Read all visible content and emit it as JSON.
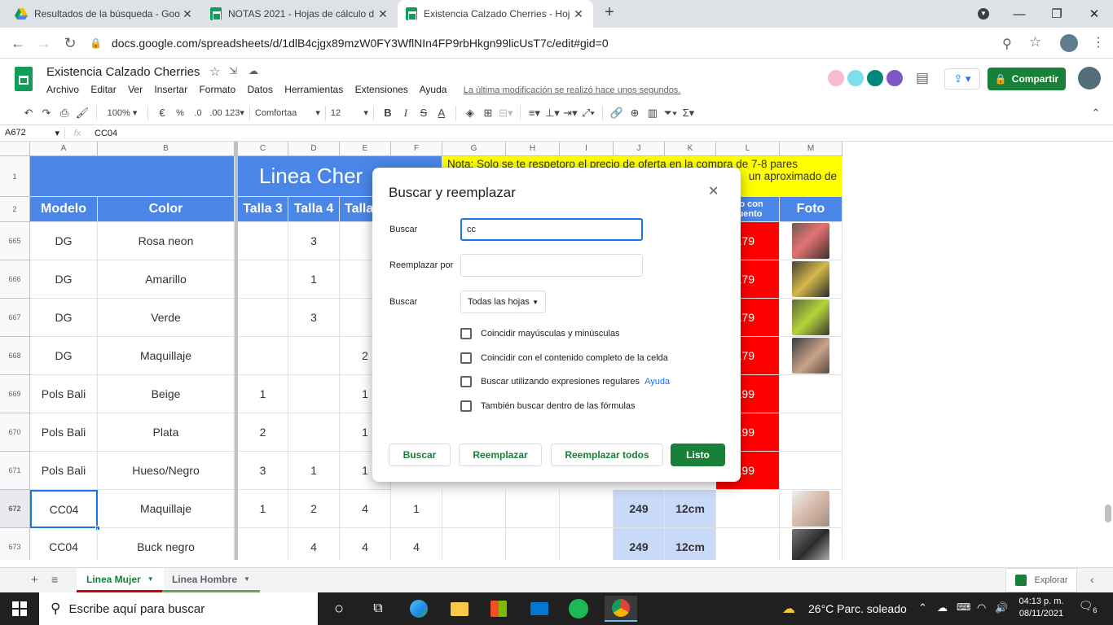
{
  "browser": {
    "tabs": [
      {
        "title": "Resultados de la búsqueda - Goo",
        "active": false,
        "icon": "drive-icon"
      },
      {
        "title": "NOTAS 2021 - Hojas de cálculo d",
        "active": false,
        "icon": "sheets-icon"
      },
      {
        "title": "Existencia Calzado Cherries - Hoj",
        "active": true,
        "icon": "sheets-icon"
      }
    ],
    "new_tab": "+",
    "url": "docs.google.com/spreadsheets/d/1dlB4cjgx89mzW0FY3WflNIn4FP9rbHkgn99licUsT7c/edit#gid=0"
  },
  "doc": {
    "title": "Existencia Calzado Cherries",
    "menu": [
      "Archivo",
      "Editar",
      "Ver",
      "Insertar",
      "Formato",
      "Datos",
      "Herramientas",
      "Extensiones",
      "Ayuda"
    ],
    "last_edit": "La última modificación se realizó hace unos segundos.",
    "share": "Compartir"
  },
  "toolbar": {
    "zoom": "100%",
    "currency": "€",
    "percent": "%",
    "dec_less": ".0",
    "dec_more": ".00",
    "format": "123",
    "font": "Comfortaa",
    "size": "12"
  },
  "formula_bar": {
    "cell_ref": "A672",
    "fx": "fx",
    "content": "CC04"
  },
  "sheet": {
    "columns": [
      "A",
      "B",
      "C",
      "D",
      "E",
      "F",
      "G",
      "H",
      "I",
      "J",
      "K",
      "L",
      "M"
    ],
    "row1_title": "Linea Cher",
    "note": "Nota: Solo se te respetoro el precio de oferta en la compra de 7-8 pares",
    "note2": "un aproximado de",
    "headers": {
      "modelo": "Modelo",
      "color": "Color",
      "t3": "Talla 3",
      "t4": "Talla 4",
      "t5": "Talla",
      "precio": "cio con\ncuento",
      "foto": "Foto"
    },
    "rows": [
      {
        "num": "665",
        "modelo": "DG",
        "color": "Rosa neon",
        "t3": "",
        "t4": "3",
        "t5": "",
        "t6": "",
        "j": "",
        "k": "",
        "l": "179",
        "photo": true
      },
      {
        "num": "666",
        "modelo": "DG",
        "color": "Amarillo",
        "t3": "",
        "t4": "1",
        "t5": "",
        "t6": "",
        "j": "",
        "k": "",
        "l": "179",
        "photo": true
      },
      {
        "num": "667",
        "modelo": "DG",
        "color": "Verde",
        "t3": "",
        "t4": "3",
        "t5": "",
        "t6": "",
        "j": "",
        "k": "",
        "l": "179",
        "photo": true
      },
      {
        "num": "668",
        "modelo": "DG",
        "color": "Maquillaje",
        "t3": "",
        "t4": "",
        "t5": "2",
        "t6": "",
        "j": "",
        "k": "",
        "l": "179",
        "photo": true
      },
      {
        "num": "669",
        "modelo": "Pols Bali",
        "color": "Beige",
        "t3": "1",
        "t4": "",
        "t5": "1",
        "t6": "",
        "j": "",
        "k": "",
        "l": "199",
        "photo": false
      },
      {
        "num": "670",
        "modelo": "Pols Bali",
        "color": "Plata",
        "t3": "2",
        "t4": "",
        "t5": "1",
        "t6": "",
        "j": "",
        "k": "",
        "l": "199",
        "photo": false
      },
      {
        "num": "671",
        "modelo": "Pols Bali",
        "color": "Hueso/Negro",
        "t3": "3",
        "t4": "1",
        "t5": "1",
        "t6": "",
        "j": "",
        "k": "",
        "l": "199",
        "photo": false
      },
      {
        "num": "672",
        "modelo": "CC04",
        "color": "Maquillaje",
        "t3": "1",
        "t4": "2",
        "t5": "4",
        "t6": "1",
        "j": "249",
        "k": "12cm",
        "l": "",
        "photo": true
      },
      {
        "num": "673",
        "modelo": "CC04",
        "color": "Buck negro",
        "t3": "",
        "t4": "4",
        "t5": "4",
        "t6": "4",
        "j": "249",
        "k": "12cm",
        "l": "",
        "photo": true
      }
    ]
  },
  "dialog": {
    "title": "Buscar y reemplazar",
    "find_label": "Buscar",
    "find_value": "cc",
    "replace_label": "Reemplazar por",
    "replace_value": "",
    "scope_label": "Buscar",
    "scope_value": "Todas las hojas",
    "options": [
      "Coincidir mayúsculas y minúsculas",
      "Coincidir con el contenido completo de la celda",
      "Buscar utilizando expresiones regulares",
      "También buscar dentro de las fórmulas"
    ],
    "help": "Ayuda",
    "buttons": {
      "find": "Buscar",
      "replace": "Reemplazar",
      "replace_all": "Reemplazar todos",
      "done": "Listo"
    }
  },
  "sheet_tabs": [
    {
      "label": "Linea Mujer",
      "active": true
    },
    {
      "label": "Linea Hombre",
      "active": false
    }
  ],
  "explore": "Explorar",
  "taskbar": {
    "search_placeholder": "Escribe aquí para buscar",
    "weather": "26°C  Parc. soleado",
    "time": "04:13 p. m.",
    "date": "08/11/2021",
    "notifications": "6"
  },
  "colors": {
    "accent_green": "#188038",
    "header_blue": "#4a86e8",
    "note_yellow": "#ffff00",
    "price_red": "#ff0000"
  }
}
